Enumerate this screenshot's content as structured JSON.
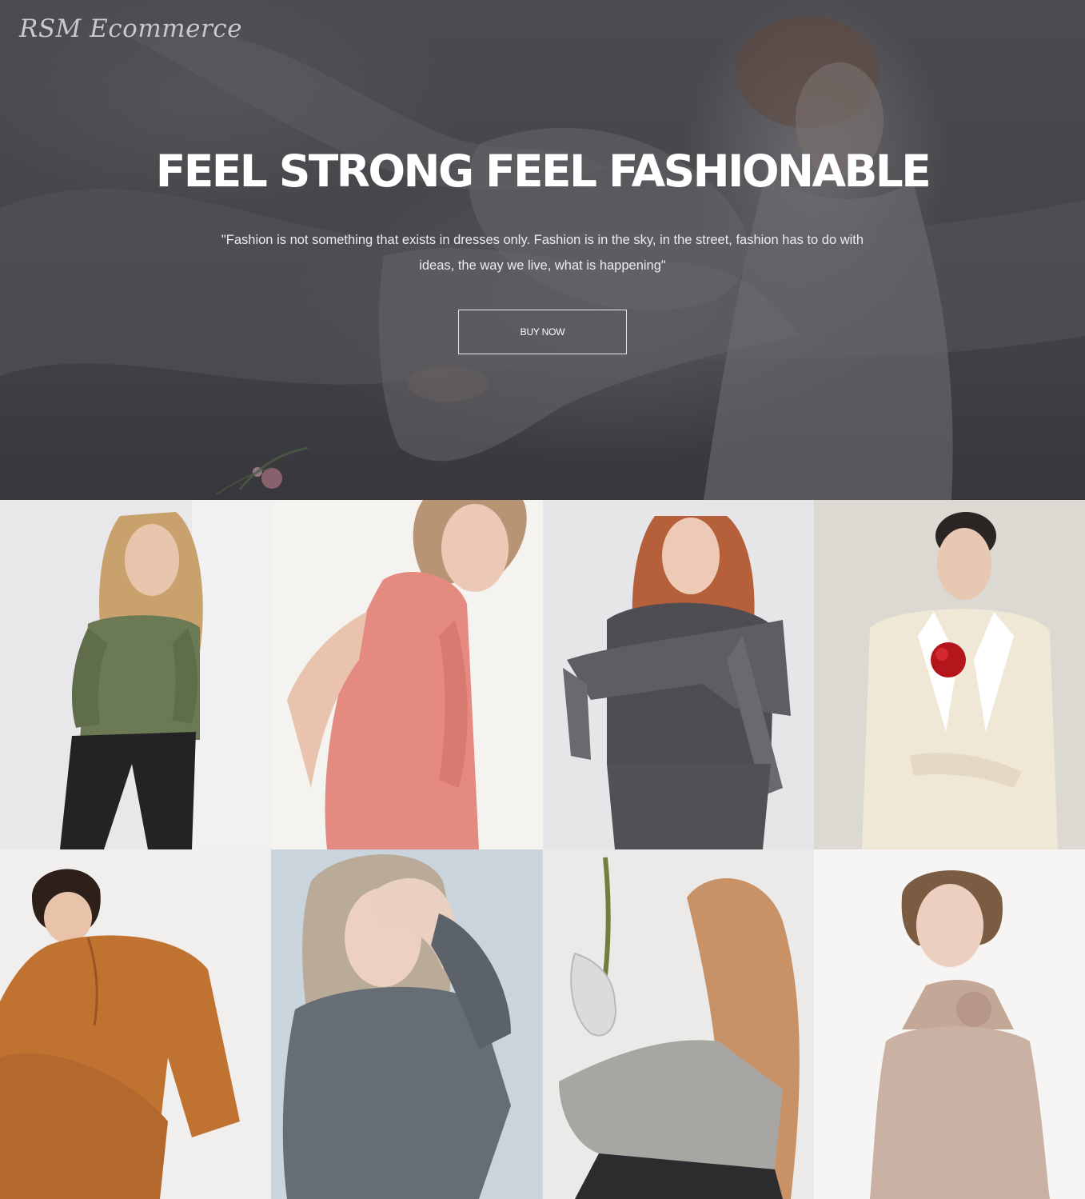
{
  "brand": {
    "logo_text": "RSM Ecommerce"
  },
  "hero": {
    "title": "FEEL STRONG FEEL FASHIONABLE",
    "quote": "\"Fashion is not something that exists in dresses only. Fashion is in the sky, in the street, fashion has to do with ideas, the way we live, what is happening\"",
    "button_label": "BUY NOW"
  },
  "products": [
    {
      "garment": "olive long-sleeve top with black jeans",
      "garment_color": "#6b7a55"
    },
    {
      "garment": "coral sleeveless top",
      "garment_color": "#e58a80"
    },
    {
      "garment": "charcoal hoodie with knit scarf",
      "garment_color": "#4e4d52"
    },
    {
      "garment": "cream blazer with red rose",
      "garment_color": "#efe8d6"
    },
    {
      "garment": "rust ruffled blouse",
      "garment_color": "#c07231"
    },
    {
      "garment": "slate grey shirt",
      "garment_color": "#666d75"
    },
    {
      "garment": "grey knit sweater",
      "garment_color": "#a7a6a3"
    },
    {
      "garment": "taupe ruffled halter top",
      "garment_color": "#c9b1a3"
    }
  ],
  "colors": {
    "hero_text": "#ffffff",
    "button_border": "#e9e9ec",
    "overlay": "#28282e"
  }
}
